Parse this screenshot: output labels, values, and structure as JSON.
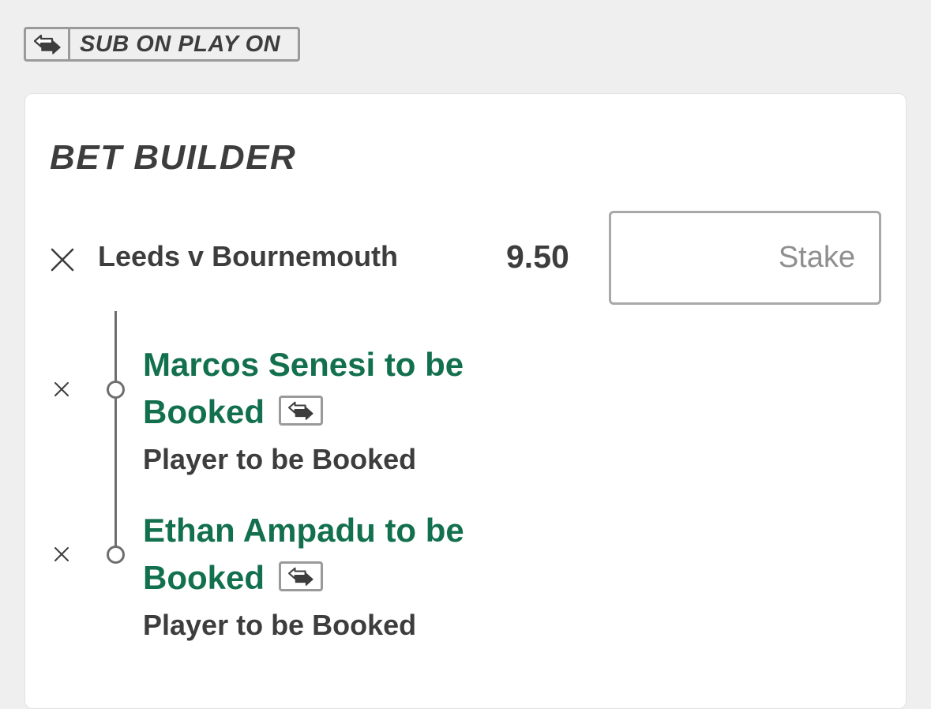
{
  "sub_badge": {
    "label": "SUB ON PLAY ON",
    "icon": "swap-arrows-icon"
  },
  "bet_builder": {
    "title": "BET BUILDER",
    "event": "Leeds v Bournemouth",
    "odds": "9.50",
    "stake_placeholder": "Stake",
    "stake_value": "",
    "remove_icon": "close-icon",
    "legs": [
      {
        "selection": "Marcos Senesi to be Booked",
        "market": "Player to be Booked",
        "badge_icon": "swap-arrows-icon"
      },
      {
        "selection": "Ethan Ampadu to be Booked",
        "market": "Player to be Booked",
        "badge_icon": "swap-arrows-icon"
      }
    ]
  },
  "colors": {
    "background": "#efefef",
    "card": "#ffffff",
    "selection_text": "#13704e",
    "primary_text": "#3d3d3d",
    "border": "#9a9a9a"
  }
}
